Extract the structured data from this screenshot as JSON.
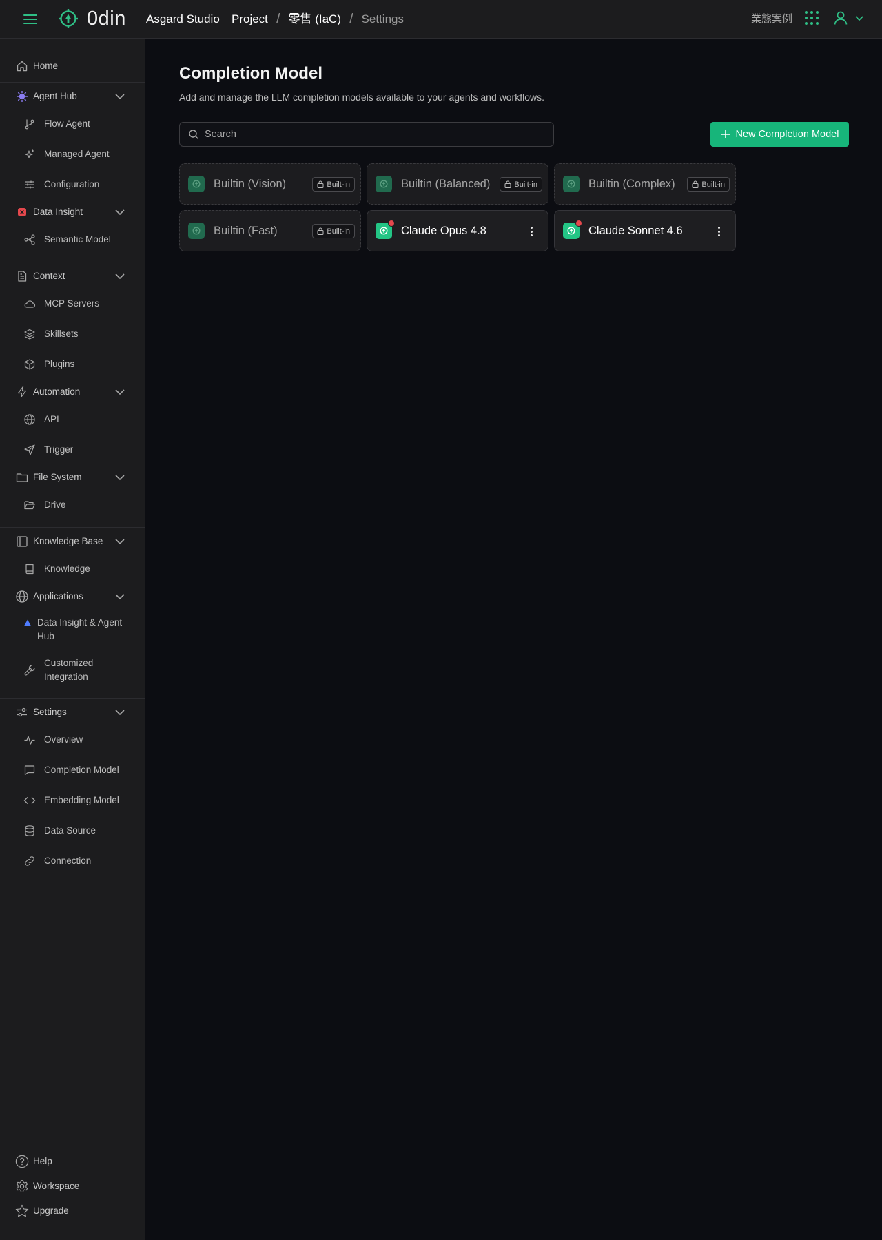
{
  "app": {
    "logo_text": "0din",
    "org_name": "Asgard Studio",
    "breadcrumb": [
      "Project",
      "零售 (IaC)",
      "Settings"
    ],
    "breadcrumb_separator": "/",
    "business_cases_label": "業態案例"
  },
  "colors": {
    "accent": "#17b57a",
    "accent_icon": "#2fbf86",
    "background": "#0c0d12",
    "panel": "#1c1c1e",
    "alert_dot": "#e5484d",
    "agent_hub_icon": "#8a7cf0",
    "data_insight_icon": "#e5484d",
    "app_triangle": "#4f7cff"
  },
  "sidebar": {
    "home": "Home",
    "agent_hub": {
      "label": "Agent Hub",
      "items": [
        "Flow Agent",
        "Managed Agent",
        "Configuration"
      ]
    },
    "data_insight": {
      "label": "Data Insight",
      "items": [
        "Semantic Model"
      ]
    },
    "context": {
      "label": "Context",
      "items": [
        "MCP Servers",
        "Skillsets",
        "Plugins"
      ]
    },
    "automation": {
      "label": "Automation",
      "items": [
        "API",
        "Trigger"
      ]
    },
    "file_system": {
      "label": "File System",
      "items": [
        "Drive"
      ]
    },
    "knowledge_base": {
      "label": "Knowledge Base",
      "items": [
        "Knowledge"
      ]
    },
    "applications": {
      "label": "Applications",
      "items": [
        {
          "line1": "Data Insight & Agent",
          "line2": "Hub"
        },
        {
          "line1": "Customized",
          "line2": "Integration"
        }
      ]
    },
    "settings": {
      "label": "Settings",
      "items": [
        "Overview",
        "Completion Model",
        "Embedding Model",
        "Data Source",
        "Connection"
      ]
    },
    "footer": {
      "help": "Help",
      "workspace": "Workspace",
      "upgrade": "Upgrade"
    }
  },
  "main": {
    "title": "Completion Model",
    "description": "Add and manage the LLM completion models available to your agents and workflows.",
    "search_placeholder": "Search",
    "new_button_label": "New Completion Model",
    "builtin_badge": "Built-in",
    "models": [
      {
        "name": "Builtin (Vision)",
        "builtin": true
      },
      {
        "name": "Builtin (Balanced)",
        "builtin": true
      },
      {
        "name": "Builtin (Complex)",
        "builtin": true
      },
      {
        "name": "Builtin (Fast)",
        "builtin": true
      },
      {
        "name": "Claude Opus 4.8",
        "builtin": false,
        "alert": true
      },
      {
        "name": "Claude Sonnet 4.6",
        "builtin": false,
        "alert": true
      }
    ]
  }
}
